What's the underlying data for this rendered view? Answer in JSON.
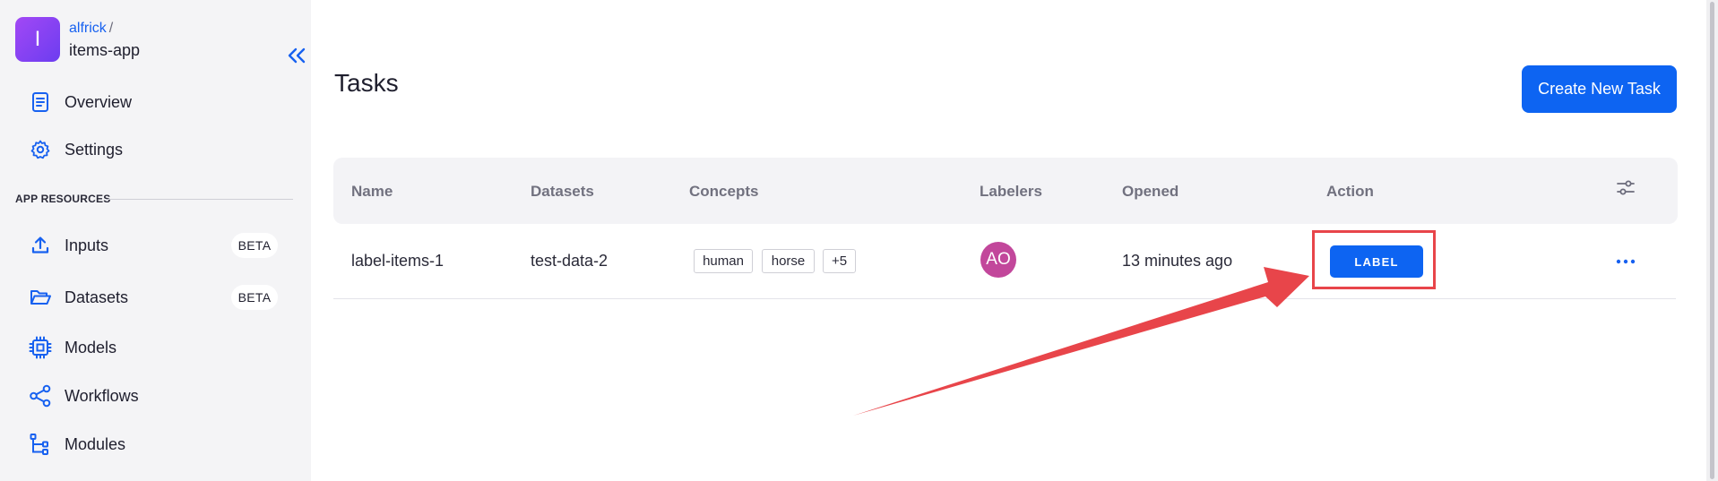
{
  "app": {
    "avatar_letter": "I",
    "owner": "alfrick",
    "separator": "/",
    "name": "items-app"
  },
  "sidebar": {
    "nav": [
      {
        "label": "Overview",
        "icon": "document-icon"
      },
      {
        "label": "Settings",
        "icon": "gear-icon"
      }
    ],
    "section_title": "APP RESOURCES",
    "resources": [
      {
        "label": "Inputs",
        "icon": "upload-icon",
        "badge": "BETA"
      },
      {
        "label": "Datasets",
        "icon": "folder-icon",
        "badge": "BETA"
      },
      {
        "label": "Models",
        "icon": "chip-icon"
      },
      {
        "label": "Workflows",
        "icon": "share-nodes-icon"
      },
      {
        "label": "Modules",
        "icon": "hierarchy-icon"
      }
    ]
  },
  "main": {
    "title": "Tasks",
    "create_button": "Create New Task",
    "columns": [
      "Name",
      "Datasets",
      "Concepts",
      "Labelers",
      "Opened",
      "Action"
    ],
    "rows": [
      {
        "name": "label-items-1",
        "dataset": "test-data-2",
        "concepts": [
          "human",
          "horse",
          "+5"
        ],
        "labeler_initials": "AO",
        "opened": "13 minutes ago",
        "action": "LABEL"
      }
    ]
  },
  "colors": {
    "accent": "#0d64f2",
    "labeler_avatar": "#c2479b",
    "annotation": "#e8454a"
  }
}
